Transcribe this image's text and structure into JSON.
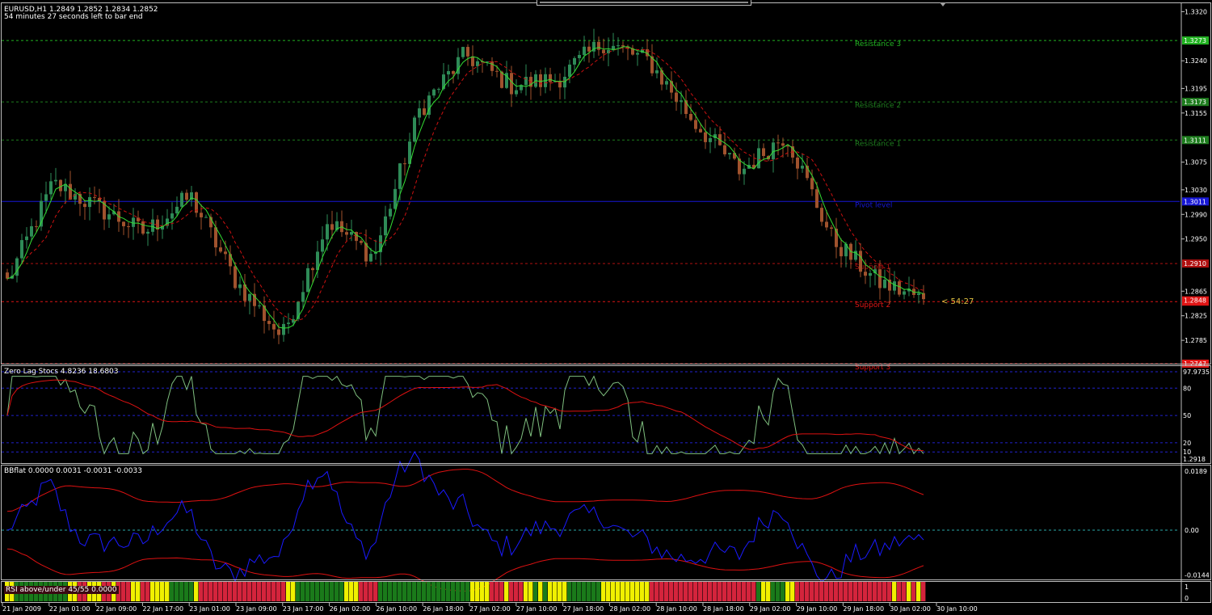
{
  "window": {
    "symbol_line": "EURUSD,H1  1.2849 1.2852 1.2834 1.2852",
    "timer_line": "54 minutes 27 seconds left to bar end"
  },
  "main_chart": {
    "timeframe": "H1",
    "symbol": "EURUSD",
    "ohlc": {
      "open": "1.2849",
      "high": "1.2852",
      "low": "1.2834",
      "close": "1.2852"
    },
    "countdown": "< 54:27",
    "price_ticks": [
      "1.3320",
      "1.3240",
      "1.3195",
      "1.3155",
      "1.3075",
      "1.3030",
      "1.2990",
      "1.2950",
      "1.2865",
      "1.2825",
      "1.2785"
    ],
    "levels": [
      {
        "name": "Resistance 3",
        "price_label": "1.3273",
        "color": "#22b322"
      },
      {
        "name": "Resistance 2",
        "price_label": "1.3173",
        "color": "#1e7d1e"
      },
      {
        "name": "Resistance 1",
        "price_label": "1.3111",
        "color": "#1e7d1e"
      },
      {
        "name": "Pivot level",
        "price_label": "1.3011",
        "color": "#1717d6"
      },
      {
        "name": "Support 1",
        "price_label": "1.2910",
        "color": "#b01010"
      },
      {
        "name": "Support 2",
        "price_label": "1.2848",
        "color": "#e01515"
      },
      {
        "name": "Support 3",
        "price_label": "1.2747",
        "color": "#e01515"
      }
    ],
    "current_price_label": "1.2848",
    "colors": {
      "bull": "#2e8b57",
      "bear": "#a0522d",
      "fast_ma": "#33dd33",
      "slow_ma": "#cc1111"
    }
  },
  "stoch_pane": {
    "title": "Zero Lag Stocs 4.8236 18.6803",
    "scale_labels": [
      "97.9735",
      "80",
      "50",
      "20",
      "10",
      "1.2918"
    ],
    "colors": {
      "main": "#7fbf7f",
      "signal": "#dd1111",
      "levels": "#2222cc"
    }
  },
  "bbflat_pane": {
    "title": "BBflat 0.0000 0.0031 -0.0031 -0.0033",
    "scale_labels": [
      "0.0189",
      "0.00",
      "-0.0144"
    ],
    "colors": {
      "line": "#1a1aff",
      "bands": "#dd1111",
      "zero": "#2aa7a7"
    }
  },
  "rsi_pane": {
    "title": "RSI above/under 45/55 0.0000",
    "scale_labels": [
      "1",
      "0"
    ],
    "colors": {
      "red": "#d4243c",
      "green": "#1a7a1a",
      "yellow": "#f0f000"
    }
  },
  "time_axis": [
    "21 Jan 2009",
    "22 Jan 01:00",
    "22 Jan 09:00",
    "22 Jan 17:00",
    "23 Jan 01:00",
    "23 Jan 09:00",
    "23 Jan 17:00",
    "26 Jan 02:00",
    "26 Jan 10:00",
    "26 Jan 18:00",
    "27 Jan 02:00",
    "27 Jan 10:00",
    "27 Jan 18:00",
    "28 Jan 02:00",
    "28 Jan 10:00",
    "28 Jan 18:00",
    "29 Jan 02:00",
    "29 Jan 10:00",
    "29 Jan 18:00",
    "30 Jan 02:00",
    "30 Jan 10:00"
  ],
  "chart_data": {
    "type": "line",
    "title": "EURUSD,H1",
    "price_path_x_labels": [
      "21 Jan 2009",
      "22 Jan 01:00",
      "22 Jan 09:00",
      "22 Jan 17:00",
      "23 Jan 01:00",
      "23 Jan 09:00",
      "23 Jan 17:00",
      "26 Jan 02:00",
      "26 Jan 10:00",
      "26 Jan 18:00",
      "27 Jan 02:00",
      "27 Jan 10:00",
      "27 Jan 18:00",
      "28 Jan 02:00",
      "28 Jan 10:00",
      "28 Jan 18:00",
      "29 Jan 02:00",
      "29 Jan 10:00",
      "29 Jan 18:00",
      "30 Jan 02:00"
    ],
    "close_path": [
      1.288,
      1.304,
      1.3,
      1.296,
      1.302,
      1.288,
      1.279,
      1.298,
      1.292,
      1.316,
      1.325,
      1.32,
      1.321,
      1.327,
      1.324,
      1.314,
      1.306,
      1.312,
      1.295,
      1.288,
      1.2852
    ],
    "ylim": [
      1.2747,
      1.3335
    ]
  }
}
